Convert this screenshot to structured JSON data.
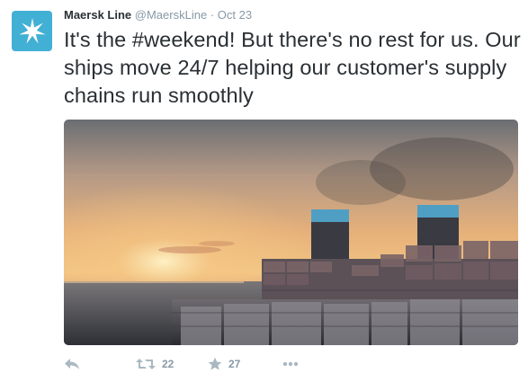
{
  "author": {
    "name": "Maersk Line",
    "handle": "@MaerskLine",
    "separator": "·",
    "time": "Oct 23"
  },
  "tweet": {
    "text_before": "It's the ",
    "hashtag": "#weekend",
    "text_after": "! But there's no rest for us. Our ships move 24/7 helping our customer's supply chains run smoothly"
  },
  "media": {
    "description_icon": "photo"
  },
  "actions": {
    "reply_icon": "reply-icon",
    "retweet_icon": "retweet-icon",
    "retweet_count": "22",
    "favorite_icon": "star-icon",
    "favorite_count": "27",
    "more_icon": "more-icon"
  },
  "colors": {
    "avatar_bg": "#42b0d5",
    "text": "#292f33",
    "meta": "#8899a6",
    "action_icon": "#aab8c2"
  }
}
